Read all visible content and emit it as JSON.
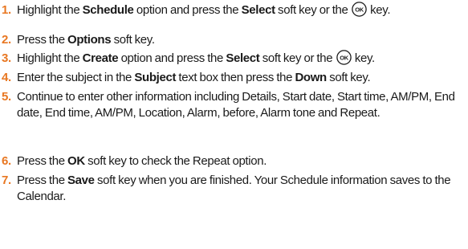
{
  "steps": [
    {
      "number": "1.",
      "parts": [
        {
          "t": "Highlight the "
        },
        {
          "t": "Schedule",
          "b": true
        },
        {
          "t": " option and press the "
        },
        {
          "t": "Select",
          "b": true
        },
        {
          "t": " soft key or the "
        },
        {
          "key": "OK"
        },
        {
          "t": " key."
        }
      ]
    },
    {
      "number": "2.",
      "parts": [
        {
          "t": "Press the "
        },
        {
          "t": "Options",
          "b": true
        },
        {
          "t": " soft key."
        }
      ]
    },
    {
      "number": "3.",
      "parts": [
        {
          "t": "Highlight the "
        },
        {
          "t": "Create",
          "b": true
        },
        {
          "t": " option and press the "
        },
        {
          "t": "Select",
          "b": true
        },
        {
          "t": " soft key or the "
        },
        {
          "key": "OK"
        },
        {
          "t": " key."
        }
      ]
    },
    {
      "number": "4.",
      "parts": [
        {
          "t": "Enter the subject in the "
        },
        {
          "t": "Subject",
          "b": true
        },
        {
          "t": " text box then press the "
        },
        {
          "t": "Down",
          "b": true
        },
        {
          "t": " soft key."
        }
      ]
    },
    {
      "number": "5.",
      "parts": [
        {
          "t": "Continue to enter other information including Details, Start date, Start time, AM/PM, End date, End time, AM/PM, Location, Alarm, before, Alarm tone and Repeat."
        }
      ]
    },
    {
      "number": "6.",
      "parts": [
        {
          "t": "Press the "
        },
        {
          "t": "OK",
          "b": true
        },
        {
          "t": " soft key to check the Repeat option."
        }
      ]
    },
    {
      "number": "7.",
      "parts": [
        {
          "t": "Press the "
        },
        {
          "t": "Save",
          "b": true
        },
        {
          "t": " soft key when you are finished. Your Schedule information saves to the Calendar."
        }
      ]
    }
  ],
  "colors": {
    "step_number": "#e87722",
    "text": "#1a1a1a"
  },
  "icons": {
    "ok_key": "ok-key-icon"
  }
}
